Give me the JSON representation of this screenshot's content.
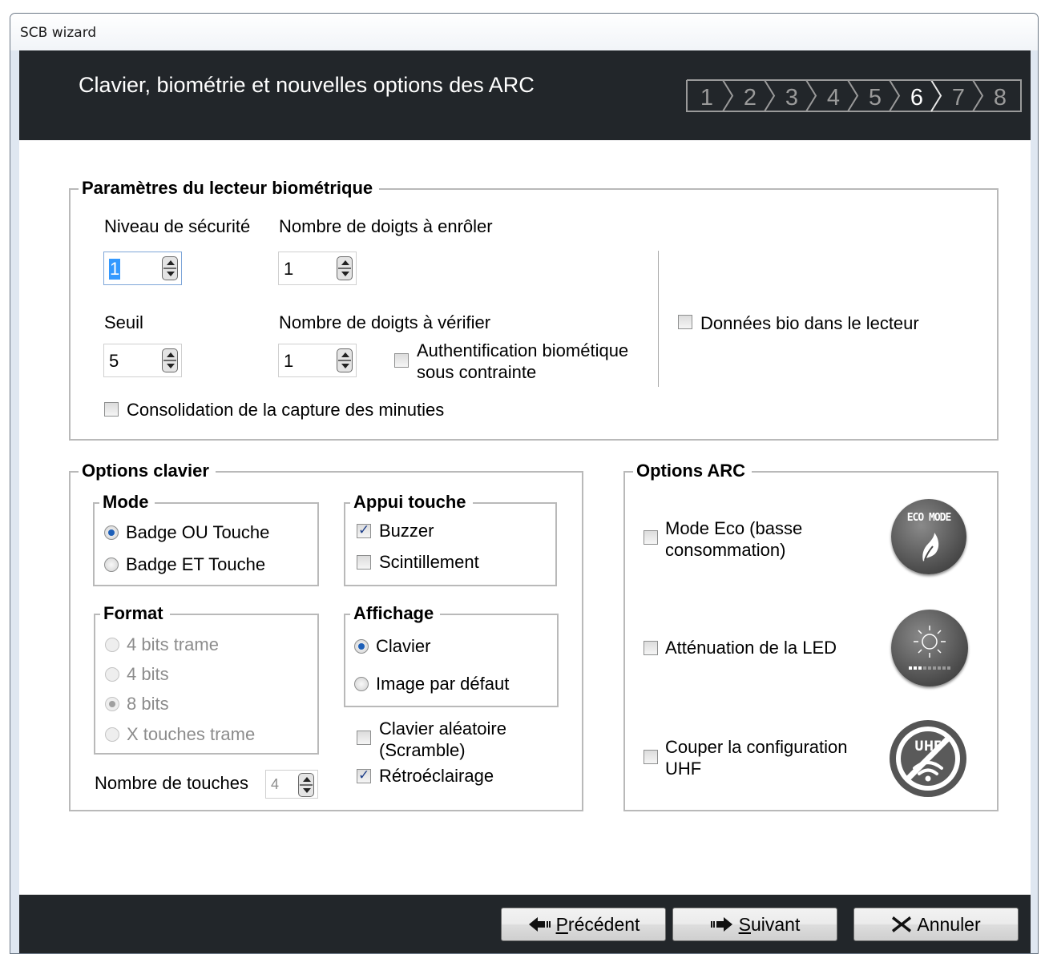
{
  "window": {
    "title": "SCB wizard"
  },
  "header": {
    "title": "Clavier, biométrie et nouvelles options des ARC",
    "steps": [
      "1",
      "2",
      "3",
      "4",
      "5",
      "6",
      "7",
      "8"
    ],
    "active_step": "6"
  },
  "biometric": {
    "legend": "Paramètres du lecteur biométrique",
    "security_level_label": "Niveau de sécurité",
    "security_level_value": "1",
    "fingers_enroll_label": "Nombre de doigts à enrôler",
    "fingers_enroll_value": "1",
    "threshold_label": "Seuil",
    "threshold_value": "5",
    "fingers_verify_label": "Nombre de doigts à vérifier",
    "fingers_verify_value": "1",
    "duress_auth_label_line1": "Authentification biométique",
    "duress_auth_label_line2": "sous contrainte",
    "duress_auth_checked": false,
    "bio_data_label": "Données bio dans le lecteur",
    "bio_data_checked": false,
    "consolidation_label": "Consolidation de la capture des minuties",
    "consolidation_checked": false
  },
  "keyboard": {
    "legend": "Options clavier",
    "mode": {
      "legend": "Mode",
      "options": [
        "Badge OU Touche",
        "Badge ET Touche"
      ],
      "selected": "Badge OU Touche"
    },
    "keypress": {
      "legend": "Appui touche",
      "buzzer_label": "Buzzer",
      "buzzer_checked": true,
      "flicker_label": "Scintillement",
      "flicker_checked": false
    },
    "format": {
      "legend": "Format",
      "options": [
        "4 bits trame",
        "4 bits",
        "8 bits",
        "X touches trame"
      ],
      "selected": "8 bits"
    },
    "display": {
      "legend": "Affichage",
      "options": [
        "Clavier",
        "Image par défaut"
      ],
      "selected": "Clavier"
    },
    "scramble_label_line1": "Clavier aléatoire",
    "scramble_label_line2": "(Scramble)",
    "scramble_checked": false,
    "backlight_label": "Rétroéclairage",
    "backlight_checked": true,
    "key_count_label": "Nombre de touches",
    "key_count_value": "4"
  },
  "arc": {
    "legend": "Options ARC",
    "eco_label_line1": "Mode Eco (basse",
    "eco_label_line2": "consommation)",
    "eco_checked": false,
    "eco_icon_text": "ECO MODE",
    "led_label": "Atténuation de la LED",
    "led_checked": false,
    "uhf_label_line1": "Couper la configuration",
    "uhf_label_line2": "UHF",
    "uhf_checked": false,
    "uhf_icon_text": "UHF"
  },
  "footer": {
    "prev_label": "Précédent",
    "prev_underline": "P",
    "prev_rest": "récédent",
    "next_underline": "S",
    "next_rest": "uivant",
    "cancel_label": "Annuler"
  }
}
